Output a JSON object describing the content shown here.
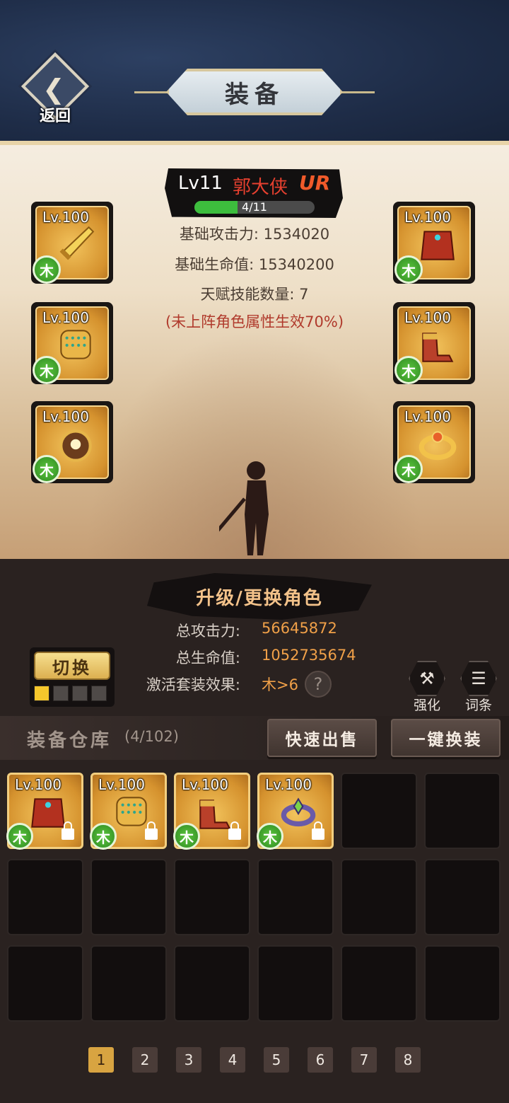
{
  "header": {
    "back_label": "返回",
    "title": "装备"
  },
  "character": {
    "level": "Lv11",
    "name": "郭大侠",
    "rarity": "UR",
    "xp_text": "4/11",
    "xp_fraction": 0.36,
    "stats": {
      "base_attack": "基础攻击力: 1534020",
      "base_hp": "基础生命值: 15340200",
      "talent_count": "天赋技能数量: 7",
      "note": "(未上阵角色属性生效70%)"
    }
  },
  "equipped": [
    {
      "level": "Lv.100",
      "element": "木",
      "item": "sword-icon"
    },
    {
      "level": "Lv.100",
      "element": "木",
      "item": "bracer-icon"
    },
    {
      "level": "Lv.100",
      "element": "木",
      "item": "amulet-icon"
    },
    {
      "level": "Lv.100",
      "element": "木",
      "item": "armor-icon"
    },
    {
      "level": "Lv.100",
      "element": "木",
      "item": "boots-icon"
    },
    {
      "level": "Lv.100",
      "element": "木",
      "item": "ring-icon"
    }
  ],
  "actions": {
    "upgrade_change": "升级/更换角色",
    "switch": "切换",
    "enhance": "强化",
    "affix": "词条",
    "quick_sell": "快速出售",
    "one_click_equip": "一键换装"
  },
  "totals": {
    "attack_label": "总攻击力:",
    "attack_value": "56645872",
    "hp_label": "总生命值:",
    "hp_value": "1052735674",
    "set_label": "激活套装效果:",
    "set_value": "木>6",
    "help": "?"
  },
  "switch_dots": [
    true,
    false,
    false,
    false
  ],
  "storage": {
    "title": "装备仓库",
    "count": "(4/102)",
    "items": [
      {
        "level": "Lv.100",
        "element": "木",
        "item": "armor-icon",
        "locked": true
      },
      {
        "level": "Lv.100",
        "element": "木",
        "item": "bracer-icon",
        "locked": true
      },
      {
        "level": "Lv.100",
        "element": "木",
        "item": "boots-icon",
        "locked": true
      },
      {
        "level": "Lv.100",
        "element": "木",
        "item": "ring-icon",
        "locked": true
      }
    ],
    "total_cells": 18
  },
  "pages": [
    "1",
    "2",
    "3",
    "4",
    "5",
    "6",
    "7",
    "8"
  ],
  "current_page": "1",
  "colors": {
    "header_bg": "#1e2c47",
    "accent_gold": "#d8a441",
    "element_green": "#3dbd3d",
    "name_red": "#e7402f",
    "value_orange": "#f0a048"
  }
}
